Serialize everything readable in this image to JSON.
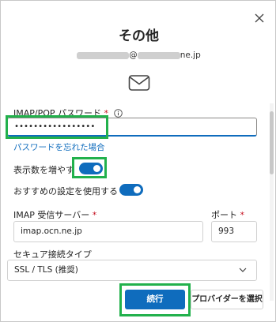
{
  "dialog": {
    "title": "その他",
    "email_visible": "@",
    "email_domain_suffix": "ne.jp",
    "close_icon": "close-icon",
    "mail_icon": "envelope-icon"
  },
  "password": {
    "label": "IMAP/POP パスワード",
    "required_mark": "*",
    "masked_value": "•••••••••••••••••",
    "forgot_link": "パスワードを忘れた場合"
  },
  "toggles": [
    {
      "label": "表示数を増やす",
      "state": "on"
    },
    {
      "label": "おすすめの設定を使用する",
      "state": "on"
    }
  ],
  "imap_server": {
    "label": "IMAP 受信サーバー",
    "required_mark": "*",
    "value": "imap.ocn.ne.jp"
  },
  "port": {
    "label": "ポート",
    "required_mark": "*",
    "value": "993"
  },
  "security": {
    "label": "セキュア接続タイプ",
    "value": "SSL / TLS (推奨)"
  },
  "buttons": {
    "continue": "続行",
    "choose_provider": "プロバイダーを選択"
  },
  "colors": {
    "accent": "#0f6cbd",
    "highlight": "#22b14c",
    "required": "#c50f1f"
  }
}
